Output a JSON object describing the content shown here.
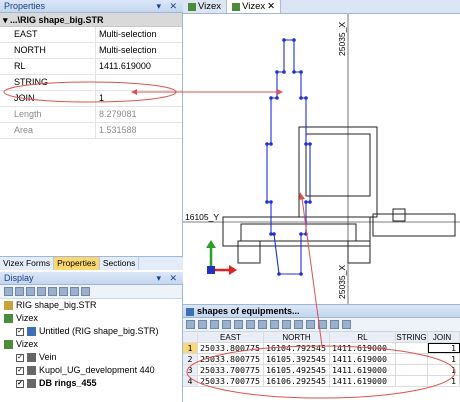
{
  "properties": {
    "title": "Properties",
    "pin_icons": "▾ ✕",
    "file": "...\\RIG shape_big.STR",
    "rows": [
      {
        "key": "EAST",
        "value": "Multi-selection",
        "dim": false
      },
      {
        "key": "NORTH",
        "value": "Multi-selection",
        "dim": false
      },
      {
        "key": "RL",
        "value": "1411.619000",
        "dim": false
      },
      {
        "key": "STRING",
        "value": "",
        "dim": false
      },
      {
        "key": "JOIN",
        "value": "1",
        "dim": false
      },
      {
        "key": "Length",
        "value": "8.279081",
        "dim": true
      },
      {
        "key": "Area",
        "value": "1.531588",
        "dim": true
      }
    ]
  },
  "left_tabs": [
    "Vizex Forms",
    "Properties",
    "Sections"
  ],
  "display": {
    "title": "Display",
    "tree": [
      {
        "label": "RIG shape_big.STR",
        "indent": 0,
        "bold": false
      },
      {
        "label": "Vizex",
        "indent": 0,
        "bold": false
      },
      {
        "label": "Untitled (RIG shape_big.STR)",
        "indent": 1,
        "bold": false
      },
      {
        "label": "Vizex",
        "indent": 0,
        "bold": false
      },
      {
        "label": "Vein",
        "indent": 1,
        "bold": false
      },
      {
        "label": "Kupol_UG_development 440",
        "indent": 1,
        "bold": false
      },
      {
        "label": "DB rings_455",
        "indent": 1,
        "bold": true
      }
    ]
  },
  "doc_tabs": [
    "Vizex",
    "Vizex"
  ],
  "viewport": {
    "label_top": "25035_X",
    "label_bottom": "25035_X",
    "label_left": "16105_Y"
  },
  "spreadsheet": {
    "title": "shapes of equipments...",
    "columns": [
      "",
      "EAST",
      "NORTH",
      "RL",
      "STRING",
      "JOIN"
    ],
    "rows": [
      [
        "1",
        "25033.800775",
        "16104.792545",
        "1411.619000",
        "",
        "1"
      ],
      [
        "2",
        "25033.800775",
        "16105.392545",
        "1411.619000",
        "",
        "1"
      ],
      [
        "3",
        "25033.700775",
        "16105.492545",
        "1411.619000",
        "",
        "1"
      ],
      [
        "4",
        "25033.700775",
        "16106.292545",
        "1411.619000",
        "",
        "1"
      ]
    ]
  },
  "colors": {
    "annotation": "#d9534f",
    "selection": "#1f2fd6",
    "tab_active": "#fbd76f"
  }
}
